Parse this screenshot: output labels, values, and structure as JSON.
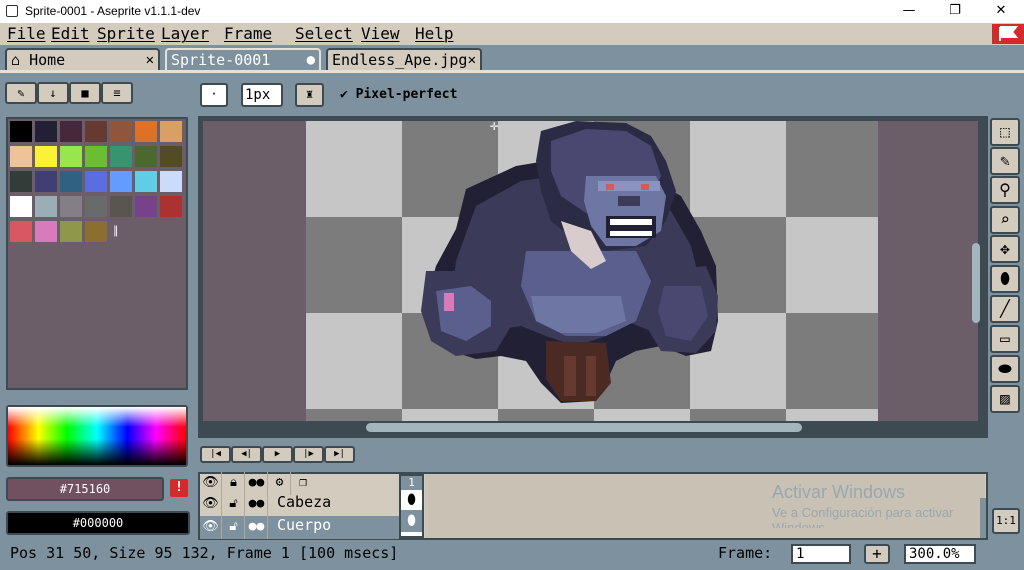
{
  "window": {
    "title": "Sprite-0001 - Aseprite v1.1.1-dev",
    "minimize": "—",
    "maximize": "❐",
    "close": "✕"
  },
  "menu": [
    "File",
    "Edit",
    "Sprite",
    "Layer",
    "Frame",
    "Select",
    "View",
    "Help"
  ],
  "tabs": [
    {
      "label": "Home",
      "close": "✕",
      "icon": "home-icon"
    },
    {
      "label": "Sprite-0001",
      "close": "●"
    },
    {
      "label": "Endless_Ape.jpg",
      "close": "✕"
    }
  ],
  "toolbar": {
    "brush_size": "1px",
    "pixel_perfect_label": "Pixel-perfect",
    "pixel_perfect_checked": true
  },
  "palette": {
    "colors": [
      "#000000",
      "#222034",
      "#45283c",
      "#663931",
      "#8f563b",
      "#df7126",
      "#d9a066",
      "#eec39a",
      "#fbf236",
      "#99e550",
      "#6abe30",
      "#37946e",
      "#4b692f",
      "#524b24",
      "#323c39",
      "#3f3f74",
      "#306082",
      "#5b6ee1",
      "#639bff",
      "#5fcde4",
      "#cbdbfc",
      "#ffffff",
      "#9badb7",
      "#847e87",
      "#696a6a",
      "#595652",
      "#76428a",
      "#ac3232",
      "#d95763",
      "#d77bba",
      "#8f974a",
      "#8a6f30"
    ]
  },
  "colors": {
    "foreground_label": "#715160",
    "foreground": "#715160",
    "background_label": "#000000",
    "background": "#000000",
    "warning": "!"
  },
  "timeline": {
    "layers": [
      {
        "name": "Cabeza",
        "selected": false
      },
      {
        "name": "Cuerpo",
        "selected": true
      }
    ],
    "frame_number": "1"
  },
  "watermark": {
    "title": "Activar Windows",
    "subtitle": "Ve a Configuración para activar",
    "subtitle2": "Windows."
  },
  "status": {
    "text": "Pos 31 50, Size 95 132, Frame 1 [100 msecs]",
    "frame_label": "Frame:",
    "frame_value": "1",
    "zoom": "300.0%",
    "one_to_one": "1:1"
  }
}
